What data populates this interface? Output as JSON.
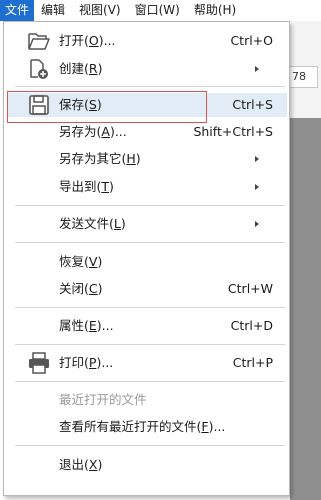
{
  "menubar": {
    "items": [
      {
        "label": "文件",
        "active": true
      },
      {
        "label": "编辑"
      },
      {
        "label": "视图(V)"
      },
      {
        "label": "窗口(W)"
      },
      {
        "label": "帮助(H)"
      }
    ]
  },
  "app": {
    "zoom_text": "78"
  },
  "file_menu": {
    "open": {
      "label": "打开(",
      "key": "O",
      "suffix": ")...",
      "shortcut": "Ctrl+O",
      "icon": "folder-open-icon"
    },
    "create": {
      "label": "创建(",
      "key": "R",
      "suffix": ")",
      "icon": "create-document-icon"
    },
    "save": {
      "label": "保存(",
      "key": "S",
      "suffix": ")",
      "shortcut": "Ctrl+S",
      "icon": "floppy-disk-icon"
    },
    "save_as": {
      "label": "另存为(",
      "key": "A",
      "suffix": ")...",
      "shortcut": "Shift+Ctrl+S"
    },
    "save_as_other": {
      "label": "另存为其它(",
      "key": "H",
      "suffix": ")"
    },
    "export_to": {
      "label": "导出到(",
      "key": "T",
      "suffix": ")"
    },
    "send_file": {
      "label": "发送文件(",
      "key": "L",
      "suffix": ")"
    },
    "revert": {
      "label": "恢复(",
      "key": "V",
      "suffix": ")"
    },
    "close": {
      "label": "关闭(",
      "key": "C",
      "suffix": ")",
      "shortcut": "Ctrl+W"
    },
    "properties": {
      "label": "属性(",
      "key": "E",
      "suffix": ")...",
      "shortcut": "Ctrl+D"
    },
    "print": {
      "label": "打印(",
      "key": "P",
      "suffix": ")...",
      "shortcut": "Ctrl+P",
      "icon": "printer-icon"
    },
    "recent_files": {
      "label": "最近打开的文件"
    },
    "view_all_recent": {
      "label": "查看所有最近打开的文件(",
      "key": "F",
      "suffix": ")..."
    },
    "exit": {
      "label": "退出(",
      "key": "X",
      "suffix": ")"
    }
  },
  "colors": {
    "highlight_border": "#d9534f",
    "active_menu": "#1f6fd1",
    "hover_bg": "#e1ecf7"
  }
}
